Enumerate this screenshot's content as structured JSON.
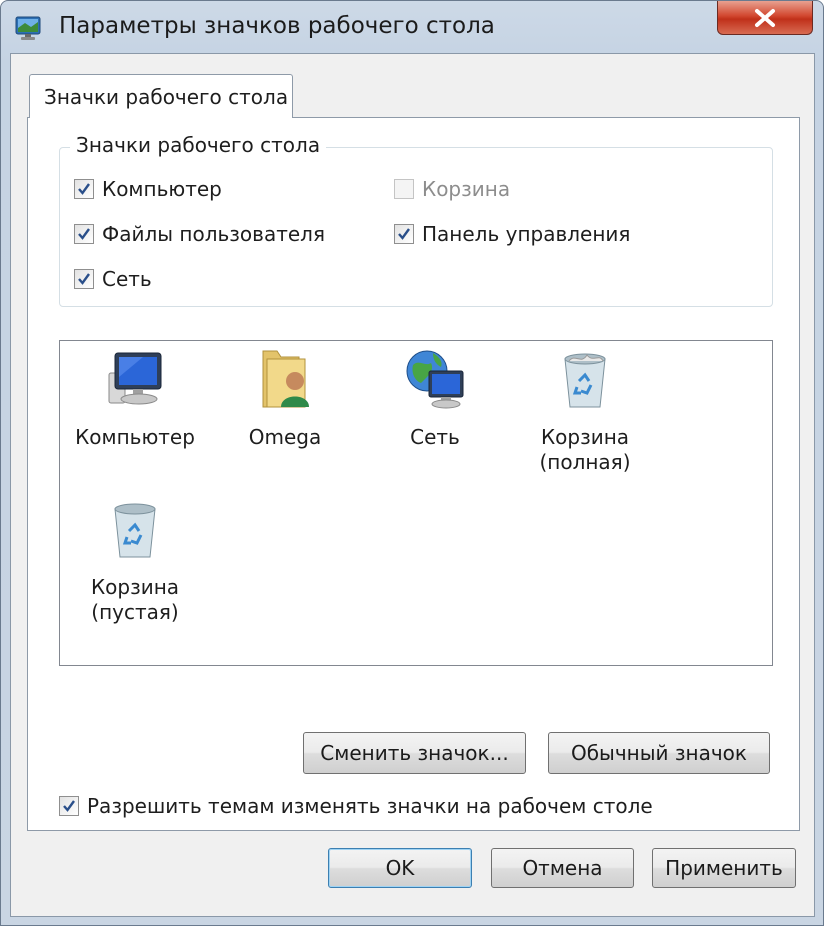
{
  "window": {
    "title": "Параметры значков рабочего стола",
    "close_glyph": "X"
  },
  "tab": {
    "label": "Значки рабочего стола"
  },
  "group": {
    "title": "Значки рабочего стола",
    "checkboxes": [
      {
        "label": "Компьютер",
        "checked": true,
        "enabled": true
      },
      {
        "label": "Файлы пользователя",
        "checked": true,
        "enabled": true
      },
      {
        "label": "Сеть",
        "checked": true,
        "enabled": true
      },
      {
        "label": "Корзина",
        "checked": false,
        "enabled": false
      },
      {
        "label": "Панель управления",
        "checked": true,
        "enabled": true
      }
    ]
  },
  "icons": [
    {
      "label": "Компьютер",
      "icon": "computer-icon"
    },
    {
      "label": "Omega",
      "icon": "user-folder-icon"
    },
    {
      "label": "Сеть",
      "icon": "network-icon"
    },
    {
      "label": "Корзина\n(полная)",
      "icon": "recycle-bin-full-icon"
    },
    {
      "label": "Корзина\n(пустая)",
      "icon": "recycle-bin-empty-icon"
    }
  ],
  "buttons": {
    "change_icon": "Сменить значок...",
    "default_icon": "Обычный значок",
    "ok": "OK",
    "cancel": "Отмена",
    "apply": "Применить"
  },
  "themes_checkbox": {
    "label": "Разрешить темам изменять значки на рабочем столе",
    "checked": true
  },
  "colors": {
    "accent": "#3c7fb1",
    "close": "#c0301a",
    "frame": "#c5d3e3"
  }
}
